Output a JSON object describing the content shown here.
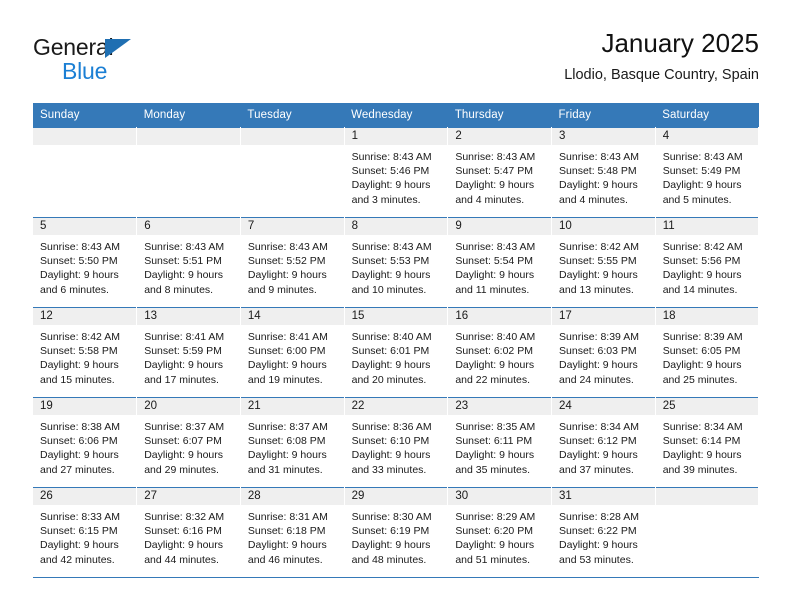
{
  "brand": {
    "name_top": "General",
    "name_bottom": "Blue",
    "accent_color": "#1b7fd4",
    "triangle_color": "#1f6fb2"
  },
  "header": {
    "title": "January 2025",
    "subtitle": "Llodio, Basque Country, Spain"
  },
  "theme": {
    "header_row_bg": "#3579b8",
    "daynum_bg": "#efefef",
    "text_color": "#1a1a1a"
  },
  "weekday_headers": [
    "Sunday",
    "Monday",
    "Tuesday",
    "Wednesday",
    "Thursday",
    "Friday",
    "Saturday"
  ],
  "weeks": [
    [
      {
        "day": "",
        "empty": true
      },
      {
        "day": "",
        "empty": true
      },
      {
        "day": "",
        "empty": true
      },
      {
        "day": "1",
        "sunrise": "Sunrise: 8:43 AM",
        "sunset": "Sunset: 5:46 PM",
        "daylight1": "Daylight: 9 hours",
        "daylight2": "and 3 minutes."
      },
      {
        "day": "2",
        "sunrise": "Sunrise: 8:43 AM",
        "sunset": "Sunset: 5:47 PM",
        "daylight1": "Daylight: 9 hours",
        "daylight2": "and 4 minutes."
      },
      {
        "day": "3",
        "sunrise": "Sunrise: 8:43 AM",
        "sunset": "Sunset: 5:48 PM",
        "daylight1": "Daylight: 9 hours",
        "daylight2": "and 4 minutes."
      },
      {
        "day": "4",
        "sunrise": "Sunrise: 8:43 AM",
        "sunset": "Sunset: 5:49 PM",
        "daylight1": "Daylight: 9 hours",
        "daylight2": "and 5 minutes."
      }
    ],
    [
      {
        "day": "5",
        "sunrise": "Sunrise: 8:43 AM",
        "sunset": "Sunset: 5:50 PM",
        "daylight1": "Daylight: 9 hours",
        "daylight2": "and 6 minutes."
      },
      {
        "day": "6",
        "sunrise": "Sunrise: 8:43 AM",
        "sunset": "Sunset: 5:51 PM",
        "daylight1": "Daylight: 9 hours",
        "daylight2": "and 8 minutes."
      },
      {
        "day": "7",
        "sunrise": "Sunrise: 8:43 AM",
        "sunset": "Sunset: 5:52 PM",
        "daylight1": "Daylight: 9 hours",
        "daylight2": "and 9 minutes."
      },
      {
        "day": "8",
        "sunrise": "Sunrise: 8:43 AM",
        "sunset": "Sunset: 5:53 PM",
        "daylight1": "Daylight: 9 hours",
        "daylight2": "and 10 minutes."
      },
      {
        "day": "9",
        "sunrise": "Sunrise: 8:43 AM",
        "sunset": "Sunset: 5:54 PM",
        "daylight1": "Daylight: 9 hours",
        "daylight2": "and 11 minutes."
      },
      {
        "day": "10",
        "sunrise": "Sunrise: 8:42 AM",
        "sunset": "Sunset: 5:55 PM",
        "daylight1": "Daylight: 9 hours",
        "daylight2": "and 13 minutes."
      },
      {
        "day": "11",
        "sunrise": "Sunrise: 8:42 AM",
        "sunset": "Sunset: 5:56 PM",
        "daylight1": "Daylight: 9 hours",
        "daylight2": "and 14 minutes."
      }
    ],
    [
      {
        "day": "12",
        "sunrise": "Sunrise: 8:42 AM",
        "sunset": "Sunset: 5:58 PM",
        "daylight1": "Daylight: 9 hours",
        "daylight2": "and 15 minutes."
      },
      {
        "day": "13",
        "sunrise": "Sunrise: 8:41 AM",
        "sunset": "Sunset: 5:59 PM",
        "daylight1": "Daylight: 9 hours",
        "daylight2": "and 17 minutes."
      },
      {
        "day": "14",
        "sunrise": "Sunrise: 8:41 AM",
        "sunset": "Sunset: 6:00 PM",
        "daylight1": "Daylight: 9 hours",
        "daylight2": "and 19 minutes."
      },
      {
        "day": "15",
        "sunrise": "Sunrise: 8:40 AM",
        "sunset": "Sunset: 6:01 PM",
        "daylight1": "Daylight: 9 hours",
        "daylight2": "and 20 minutes."
      },
      {
        "day": "16",
        "sunrise": "Sunrise: 8:40 AM",
        "sunset": "Sunset: 6:02 PM",
        "daylight1": "Daylight: 9 hours",
        "daylight2": "and 22 minutes."
      },
      {
        "day": "17",
        "sunrise": "Sunrise: 8:39 AM",
        "sunset": "Sunset: 6:03 PM",
        "daylight1": "Daylight: 9 hours",
        "daylight2": "and 24 minutes."
      },
      {
        "day": "18",
        "sunrise": "Sunrise: 8:39 AM",
        "sunset": "Sunset: 6:05 PM",
        "daylight1": "Daylight: 9 hours",
        "daylight2": "and 25 minutes."
      }
    ],
    [
      {
        "day": "19",
        "sunrise": "Sunrise: 8:38 AM",
        "sunset": "Sunset: 6:06 PM",
        "daylight1": "Daylight: 9 hours",
        "daylight2": "and 27 minutes."
      },
      {
        "day": "20",
        "sunrise": "Sunrise: 8:37 AM",
        "sunset": "Sunset: 6:07 PM",
        "daylight1": "Daylight: 9 hours",
        "daylight2": "and 29 minutes."
      },
      {
        "day": "21",
        "sunrise": "Sunrise: 8:37 AM",
        "sunset": "Sunset: 6:08 PM",
        "daylight1": "Daylight: 9 hours",
        "daylight2": "and 31 minutes."
      },
      {
        "day": "22",
        "sunrise": "Sunrise: 8:36 AM",
        "sunset": "Sunset: 6:10 PM",
        "daylight1": "Daylight: 9 hours",
        "daylight2": "and 33 minutes."
      },
      {
        "day": "23",
        "sunrise": "Sunrise: 8:35 AM",
        "sunset": "Sunset: 6:11 PM",
        "daylight1": "Daylight: 9 hours",
        "daylight2": "and 35 minutes."
      },
      {
        "day": "24",
        "sunrise": "Sunrise: 8:34 AM",
        "sunset": "Sunset: 6:12 PM",
        "daylight1": "Daylight: 9 hours",
        "daylight2": "and 37 minutes."
      },
      {
        "day": "25",
        "sunrise": "Sunrise: 8:34 AM",
        "sunset": "Sunset: 6:14 PM",
        "daylight1": "Daylight: 9 hours",
        "daylight2": "and 39 minutes."
      }
    ],
    [
      {
        "day": "26",
        "sunrise": "Sunrise: 8:33 AM",
        "sunset": "Sunset: 6:15 PM",
        "daylight1": "Daylight: 9 hours",
        "daylight2": "and 42 minutes."
      },
      {
        "day": "27",
        "sunrise": "Sunrise: 8:32 AM",
        "sunset": "Sunset: 6:16 PM",
        "daylight1": "Daylight: 9 hours",
        "daylight2": "and 44 minutes."
      },
      {
        "day": "28",
        "sunrise": "Sunrise: 8:31 AM",
        "sunset": "Sunset: 6:18 PM",
        "daylight1": "Daylight: 9 hours",
        "daylight2": "and 46 minutes."
      },
      {
        "day": "29",
        "sunrise": "Sunrise: 8:30 AM",
        "sunset": "Sunset: 6:19 PM",
        "daylight1": "Daylight: 9 hours",
        "daylight2": "and 48 minutes."
      },
      {
        "day": "30",
        "sunrise": "Sunrise: 8:29 AM",
        "sunset": "Sunset: 6:20 PM",
        "daylight1": "Daylight: 9 hours",
        "daylight2": "and 51 minutes."
      },
      {
        "day": "31",
        "sunrise": "Sunrise: 8:28 AM",
        "sunset": "Sunset: 6:22 PM",
        "daylight1": "Daylight: 9 hours",
        "daylight2": "and 53 minutes."
      },
      {
        "day": "",
        "empty": true
      }
    ]
  ]
}
